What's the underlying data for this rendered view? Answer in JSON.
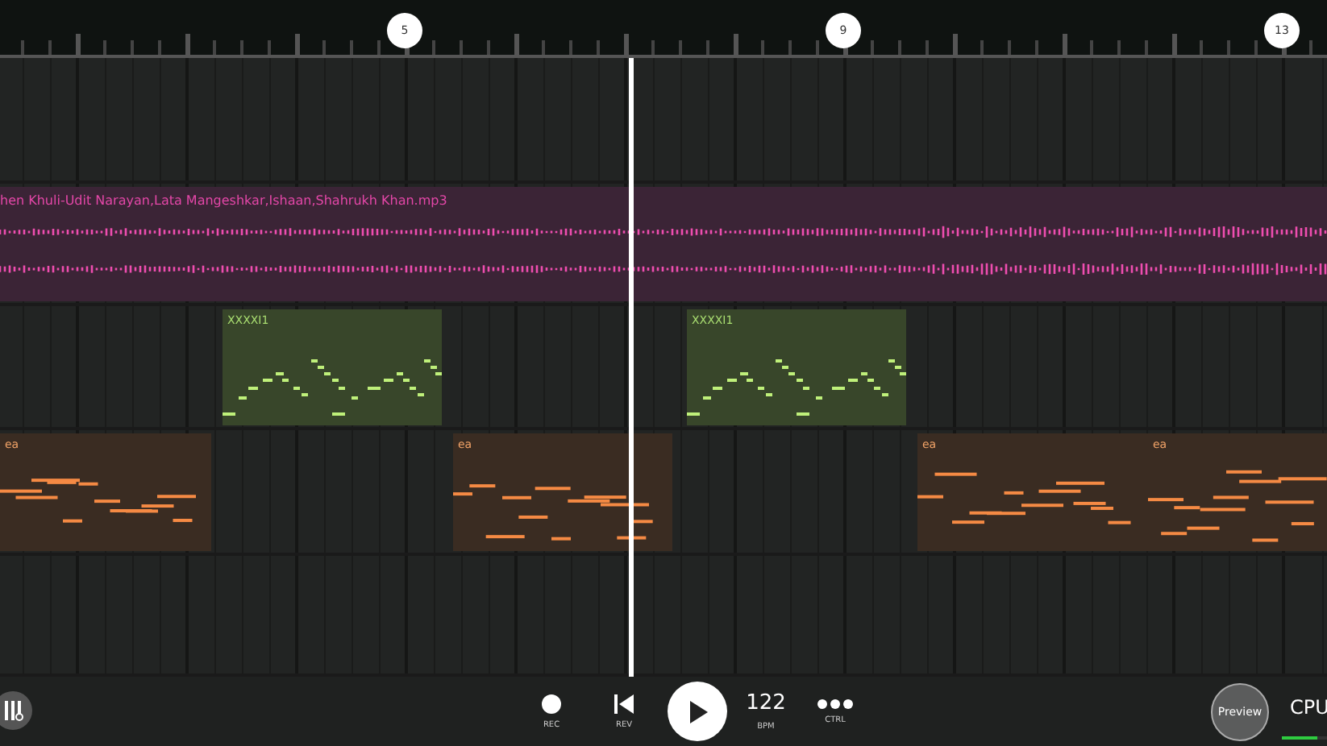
{
  "ruler": {
    "markers": [
      "5",
      "9",
      "13"
    ]
  },
  "audio_track": {
    "clip_name": "hen Khuli-Udit Narayan,Lata Mangeshkar,Ishaan,Shahrukh Khan.mp3"
  },
  "midi_clips": [
    {
      "label": "XXXXI1"
    },
    {
      "label": "XXXXI1"
    }
  ],
  "pattern_clips": [
    {
      "label": "ea"
    },
    {
      "label": "ea"
    },
    {
      "label": "ea"
    },
    {
      "label": "ea"
    }
  ],
  "transport": [
    {
      "kind": "record",
      "label": "REC"
    },
    {
      "kind": "rewind",
      "label": "REV"
    },
    {
      "kind": "play"
    },
    {
      "kind": "tempo",
      "value": "122",
      "label": "BPM"
    },
    {
      "kind": "more",
      "label": "CTRL"
    }
  ],
  "preview_button": "Preview",
  "cpu": {
    "label": "CPU",
    "level": 0.8
  }
}
